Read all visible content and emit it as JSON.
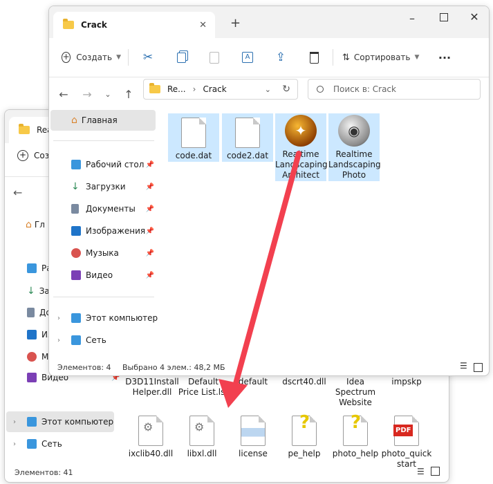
{
  "back_window": {
    "tab_title": "Rea",
    "create_label": "Созд",
    "sidebar": [
      {
        "label": "Гл",
        "icon": "home-icon"
      },
      {
        "label": "Ра",
        "icon": "desktop-icon"
      },
      {
        "label": "За",
        "icon": "download-icon"
      },
      {
        "label": "До",
        "icon": "documents-icon"
      },
      {
        "label": "Из",
        "icon": "pictures-icon"
      },
      {
        "label": "Му",
        "icon": "music-icon"
      },
      {
        "label": "Видео",
        "icon": "video-icon"
      },
      {
        "label": "Этот компьютер",
        "icon": "computer-icon"
      },
      {
        "label": "Сеть",
        "icon": "network-icon"
      }
    ],
    "files_row1": [
      "D3D11InstallHelper.dll",
      "Default Price List.lst",
      "default",
      "dscrt40.dll",
      "Idea Spectrum Website",
      "impskp"
    ],
    "files_row2": [
      {
        "name": "ixclib40.dll",
        "icon": "dll-icon"
      },
      {
        "name": "libxl.dll",
        "icon": "dll-icon"
      },
      {
        "name": "license",
        "icon": "document-icon"
      },
      {
        "name": "pe_help",
        "icon": "help-icon"
      },
      {
        "name": "photo_help",
        "icon": "help-icon"
      },
      {
        "name": "photo_quickstart",
        "icon": "pdf-icon"
      }
    ],
    "pdf_label": "PDF",
    "status_count": "Элементов: 41"
  },
  "front_window": {
    "tab_title": "Crack",
    "new_tab": "+",
    "toolbar": {
      "create_label": "Создать",
      "sort_label": "Сортировать",
      "more_label": "···"
    },
    "address": {
      "segments": [
        "Re...",
        "Crack"
      ],
      "search_placeholder": "Поиск в: Crack"
    },
    "sidebar": {
      "home": "Главная",
      "pinned": [
        {
          "label": "Рабочий стол",
          "icon": "desktop-icon"
        },
        {
          "label": "Загрузки",
          "icon": "download-icon"
        },
        {
          "label": "Документы",
          "icon": "documents-icon"
        },
        {
          "label": "Изображения",
          "icon": "pictures-icon"
        },
        {
          "label": "Музыка",
          "icon": "music-icon"
        },
        {
          "label": "Видео",
          "icon": "video-icon"
        }
      ],
      "this_pc": "Этот компьютер",
      "network": "Сеть"
    },
    "files": [
      {
        "name": "code.dat",
        "icon": "file-icon",
        "selected": true
      },
      {
        "name": "code2.dat",
        "icon": "file-icon",
        "selected": true
      },
      {
        "name": "Realtime Landscaping Architect",
        "icon": "compass-app-icon",
        "selected": true
      },
      {
        "name": "Realtime Landscaping Photo",
        "icon": "camera-app-icon",
        "selected": true
      }
    ],
    "status": {
      "count": "Элементов: 4",
      "selection": "Выбрано 4 элем.: 48,2 МБ"
    }
  },
  "colors": {
    "selection": "#cce8ff",
    "arrow": "#f2404f",
    "folder": "#f7c948"
  }
}
